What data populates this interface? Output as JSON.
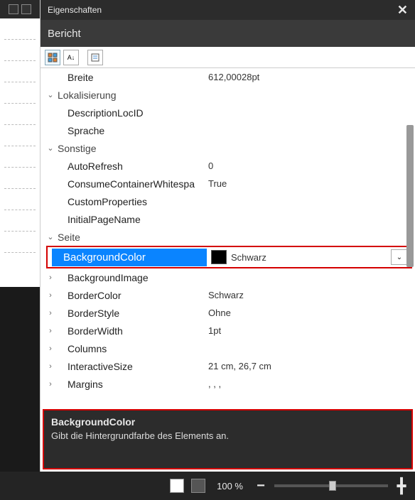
{
  "panel": {
    "title": "Eigenschaften",
    "object_name": "Bericht"
  },
  "rows": [
    {
      "type": "prop",
      "indent": 1,
      "label": "Breite",
      "value": "612,00028pt"
    },
    {
      "type": "cat",
      "exp": "v",
      "label": "Lokalisierung"
    },
    {
      "type": "prop",
      "indent": 1,
      "label": "DescriptionLocID",
      "value": ""
    },
    {
      "type": "prop",
      "indent": 1,
      "label": "Sprache",
      "value": ""
    },
    {
      "type": "cat",
      "exp": "v",
      "label": "Sonstige"
    },
    {
      "type": "prop",
      "indent": 1,
      "label": "AutoRefresh",
      "value": "0"
    },
    {
      "type": "prop",
      "indent": 1,
      "label": "ConsumeContainerWhitespace",
      "value": "True",
      "truncLabel": "ConsumeContainerWhitespa"
    },
    {
      "type": "prop",
      "indent": 1,
      "label": "CustomProperties",
      "value": ""
    },
    {
      "type": "prop",
      "indent": 1,
      "label": "InitialPageName",
      "value": ""
    },
    {
      "type": "cat",
      "exp": "v",
      "label": "Seite"
    }
  ],
  "selected": {
    "label": "BackgroundColor",
    "value": "Schwarz",
    "swatch": "#000000"
  },
  "rows_after": [
    {
      "exp": ">",
      "label": "BackgroundImage",
      "value": ""
    },
    {
      "exp": ">",
      "label": "BorderColor",
      "value": "Schwarz"
    },
    {
      "exp": ">",
      "label": "BorderStyle",
      "value": "Ohne"
    },
    {
      "exp": ">",
      "label": "BorderWidth",
      "value": "1pt"
    },
    {
      "exp": ">",
      "label": "Columns",
      "value": ""
    },
    {
      "exp": ">",
      "label": "InteractiveSize",
      "value": "21 cm, 26,7 cm"
    },
    {
      "exp": ">",
      "label": "Margins",
      "value": ", , ,"
    }
  ],
  "description": {
    "title": "BackgroundColor",
    "text": "Gibt die Hintergrundfarbe des Elements an."
  },
  "footer": {
    "zoom": "100 %"
  }
}
